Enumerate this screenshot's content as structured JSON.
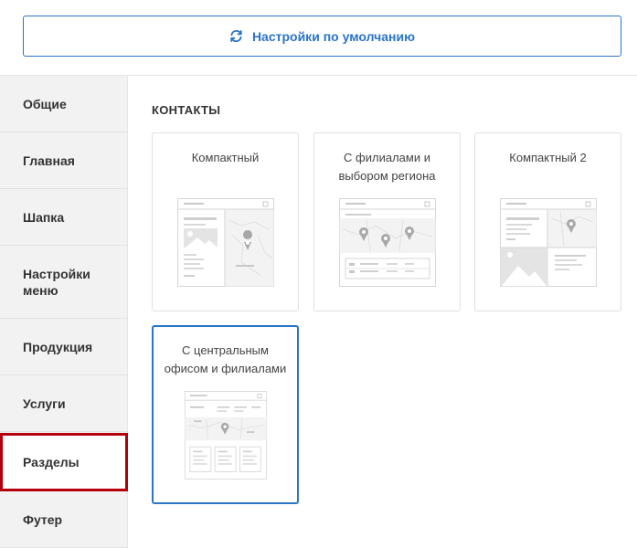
{
  "header": {
    "reset_label": "Настройки по умолчанию",
    "reset_icon": "refresh-icon",
    "accent_color": "#2a74c9"
  },
  "sidebar": {
    "items": [
      {
        "label": "Общие"
      },
      {
        "label": "Главная"
      },
      {
        "label": "Шапка"
      },
      {
        "label": "Настройки меню"
      },
      {
        "label": "Продукция"
      },
      {
        "label": "Услуги"
      },
      {
        "label": "Разделы",
        "active": true
      },
      {
        "label": "Футер"
      }
    ],
    "active_border_color": "#b3000c"
  },
  "main": {
    "section_title": "КОНТАКТЫ",
    "cards": [
      {
        "label": "Компактный"
      },
      {
        "label": "С филиалами и выбором региона"
      },
      {
        "label": "Компактный 2"
      },
      {
        "label": "С центральным офисом и филиалами",
        "selected": true
      }
    ]
  }
}
